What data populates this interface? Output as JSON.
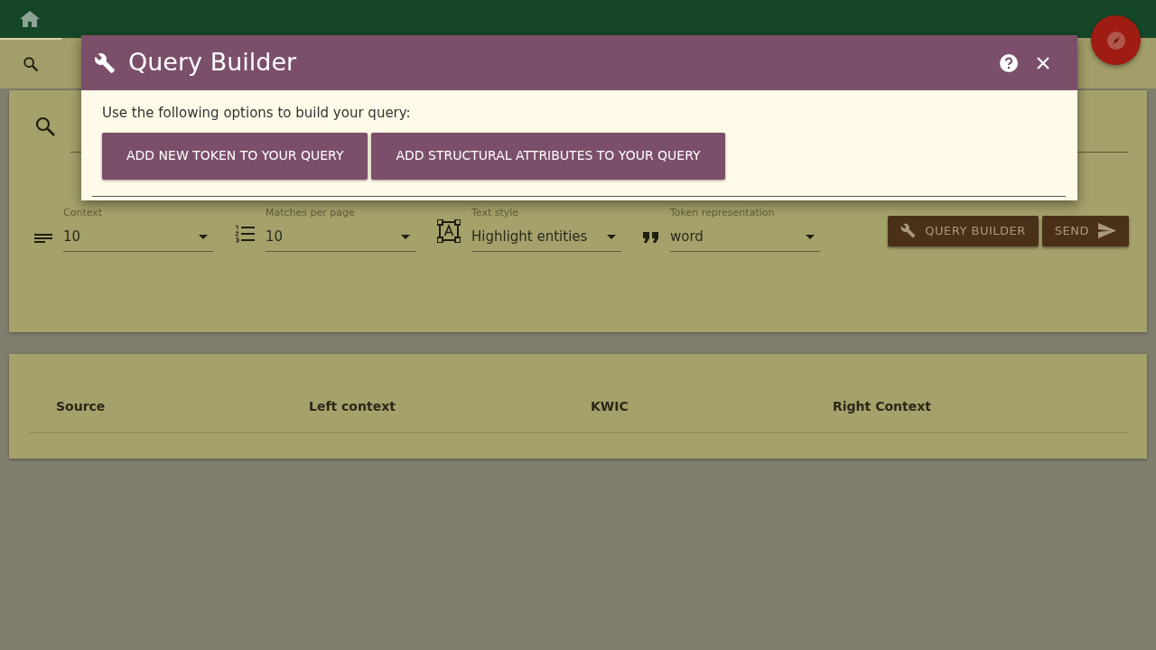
{
  "modal": {
    "title": "Query Builder",
    "intro": "Use the following options to build your query:",
    "buttons": [
      {
        "label": "ADD NEW TOKEN TO YOUR QUERY"
      },
      {
        "label": "ADD STRUCTURAL ATTRIBUTES TO YOUR QUERY"
      }
    ]
  },
  "query_form": {
    "selects": [
      {
        "label": "Context",
        "value": "10"
      },
      {
        "label": "Matches per page",
        "value": "10"
      },
      {
        "label": "Text style",
        "value": "Highlight entities"
      },
      {
        "label": "Token representation",
        "value": "word"
      }
    ],
    "buttons": [
      {
        "label": "QUERY BUILDER"
      },
      {
        "label": "SEND"
      }
    ]
  },
  "results_table": {
    "columns": [
      "Source",
      "Left context",
      "KWIC",
      "Right Context"
    ]
  }
}
